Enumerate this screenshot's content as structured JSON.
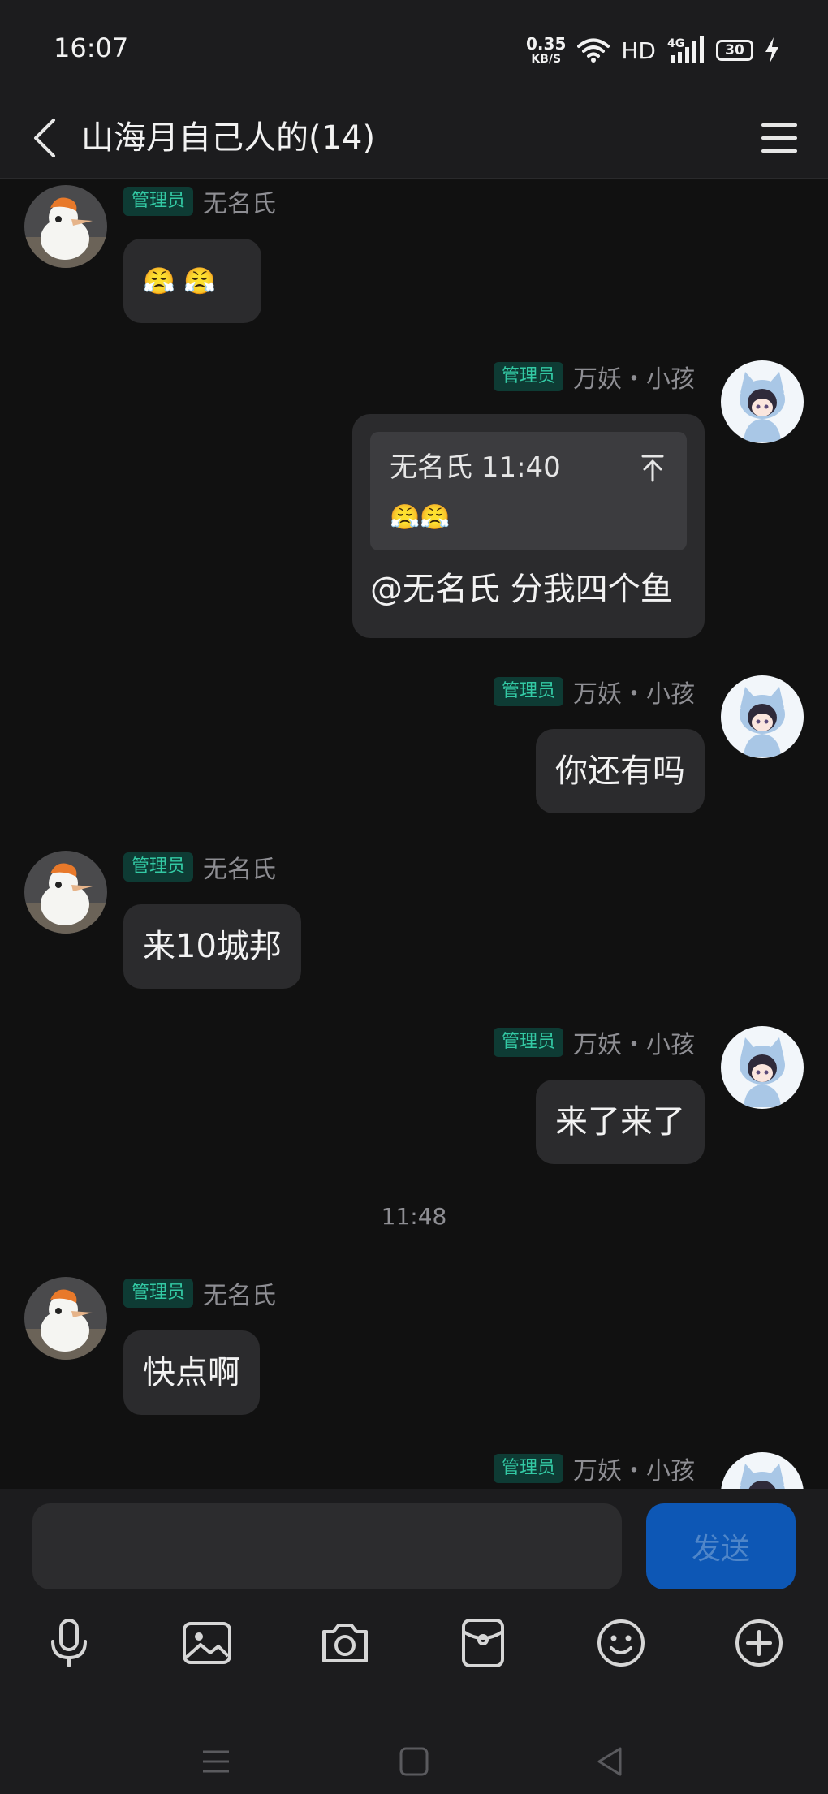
{
  "status_bar": {
    "time": "16:07",
    "net_speed_value": "0.35",
    "net_speed_unit": "KB/S",
    "hd": "HD",
    "network": "4G",
    "battery": "30"
  },
  "header": {
    "title": "山海月自己人的(14)"
  },
  "messages": [
    {
      "sender": "无名氏",
      "badge": "管理员",
      "side": "left",
      "content": "😤 😤"
    },
    {
      "sender": "万妖・小孩",
      "badge": "管理员",
      "side": "right",
      "quote": {
        "author_time": "无名氏 11:40",
        "content": "😤😤"
      },
      "content": "@无名氏 分我四个鱼"
    },
    {
      "sender": "万妖・小孩",
      "badge": "管理员",
      "side": "right",
      "content": "你还有吗"
    },
    {
      "sender": "无名氏",
      "badge": "管理员",
      "side": "left",
      "content": "来10城邦"
    },
    {
      "sender": "万妖・小孩",
      "badge": "管理员",
      "side": "right",
      "content": "来了来了"
    },
    {
      "sender": "无名氏",
      "badge": "管理员",
      "side": "left",
      "content": "快点啊"
    },
    {
      "sender": "万妖・小孩",
      "badge": "管理员",
      "side": "right",
      "content": ""
    }
  ],
  "time_divider": "11:48",
  "input": {
    "placeholder": "",
    "send_label": "发送"
  },
  "toolbar_icons": [
    "microphone-icon",
    "image-icon",
    "camera-icon",
    "red-packet-icon",
    "emoji-icon",
    "plus-icon"
  ],
  "colors": {
    "background": "#111111",
    "bubble": "#2b2b2d",
    "badge_text": "#33c9a4",
    "send_button": "#0d57b5"
  }
}
